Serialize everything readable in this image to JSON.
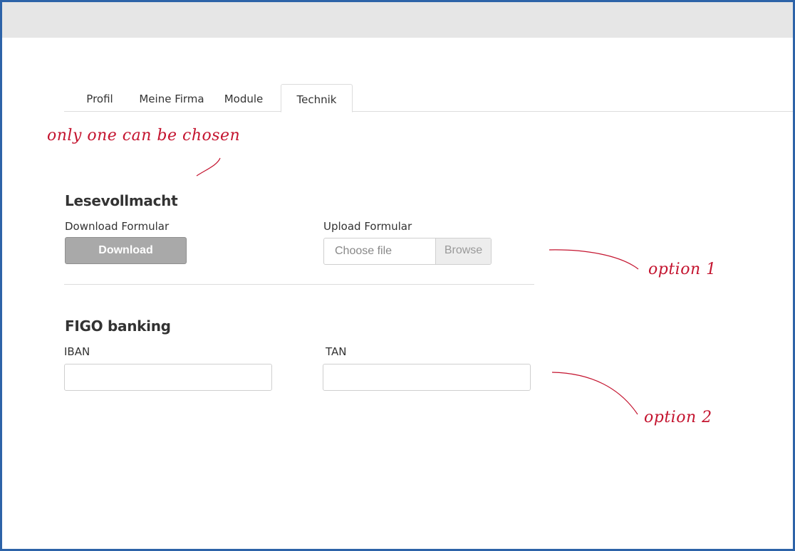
{
  "tabs": [
    {
      "label": "Profil"
    },
    {
      "label": "Meine Firma"
    },
    {
      "label": "Module"
    },
    {
      "label": "Technik"
    }
  ],
  "active_tab": "Technik",
  "annotations": {
    "note_top": "only one can be chosen",
    "option1": "option 1",
    "option2": "option 2",
    "color": "#c4142f"
  },
  "lesevollmacht": {
    "title": "Lesevollmacht",
    "download_label": "Download Formular",
    "download_button": "Download",
    "upload_label": "Upload Formular",
    "file_placeholder": "Choose file",
    "browse_button": "Browse"
  },
  "figo": {
    "title": "FIGO banking",
    "iban_label": "IBAN",
    "iban_value": "",
    "tan_label": "TAN",
    "tan_value": ""
  },
  "colors": {
    "frame_border": "#2d63a8",
    "topbar": "#e6e6e6",
    "download_button_bg": "#a9a9a9"
  }
}
